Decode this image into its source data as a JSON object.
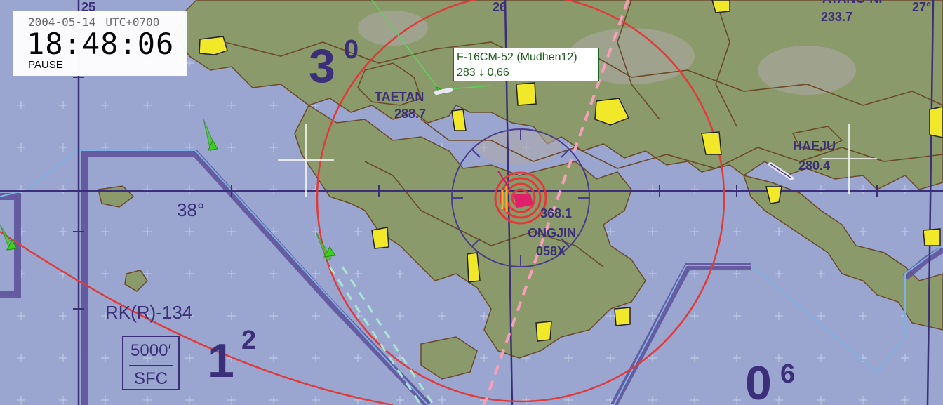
{
  "clock": {
    "date": "2004-05-14",
    "timezone": "UTC+0700",
    "time": "18:48:06",
    "state": "PAUSE"
  },
  "selected_aircraft": {
    "name": "F-16CM-52 (Mudhen12)",
    "info": "283 ↓ 0,66"
  },
  "map": {
    "latitude_label": "38°",
    "airspace": "RK(R)-134",
    "altitude_top": "5000′",
    "altitude_bottom": "SFC",
    "places": [
      {
        "name": "TAETAN",
        "freq": "288.7"
      },
      {
        "name": "HAEJU",
        "freq": "280.4"
      },
      {
        "name": "ATANG-NI",
        "freq": "233.7"
      }
    ],
    "navaid": {
      "freq": "368.1",
      "name": "ONGJIN",
      "channel": "058X"
    },
    "grid_numbers": [
      {
        "main": "3",
        "sup": "0"
      },
      {
        "main": "1",
        "sup": "2"
      },
      {
        "main": "0",
        "sup": "6"
      }
    ],
    "edge_labels": [
      "25",
      "26",
      "27°"
    ]
  },
  "colors": {
    "water": "#9aa6cf",
    "land": "#8a9a6a",
    "airspace": "#3c2f7a",
    "threat_ring": "#e03a3a",
    "friendly": "#3ad020",
    "label_border": "#1a6a1a",
    "airfield": "#f2e82a"
  }
}
